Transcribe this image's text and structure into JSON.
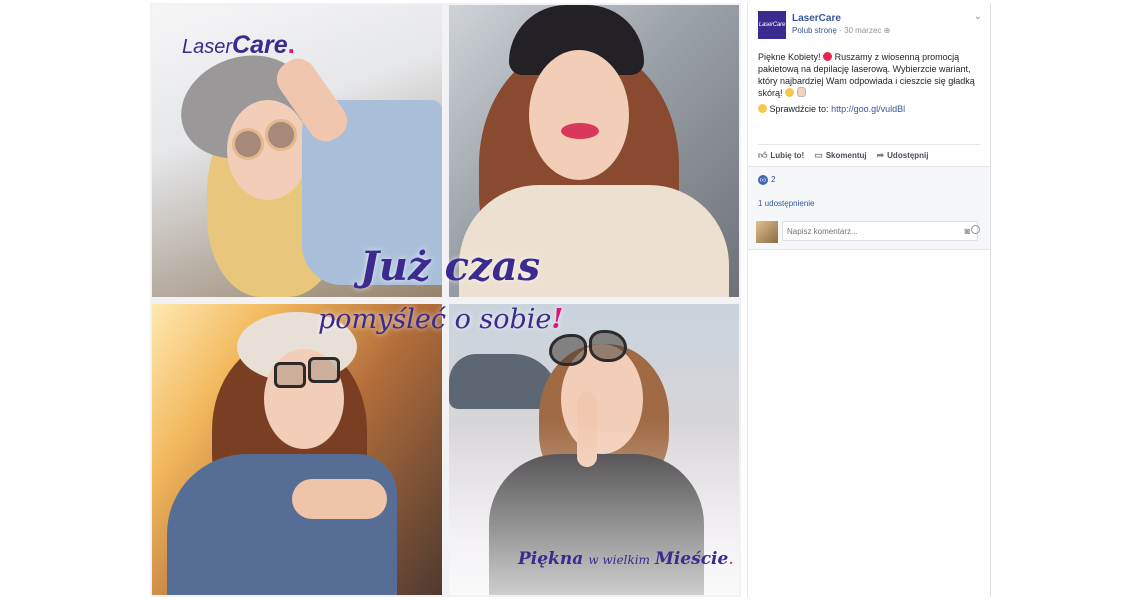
{
  "ad": {
    "logo_part1": "Laser",
    "logo_part2": "Care",
    "logo_dot": ".",
    "headline_line1": "Już czas",
    "headline_line2": "pomyśleć o sobie",
    "headline_bang": "!",
    "tagline_word1": "Piękna",
    "tagline_middle": "w wielkim",
    "tagline_word2": "Mieście",
    "tagline_dot": ".",
    "colors": {
      "brand_purple": "#3b2a8f",
      "brand_pink": "#e0117f"
    }
  },
  "post": {
    "page_avatar_text": "LaserCare",
    "page_name": "LaserCare",
    "like_page": "Polub stronę",
    "separator": "·",
    "date": "30 marzec",
    "privacy_icon": "globe-icon",
    "options_icon": "chevron-down-icon",
    "text_part1": "Piękne Kobiety!",
    "text_part2": "Ruszamy z wiosenną promocją pakietową na depilację laserową. Wybierzcie wariant, który najbardziej Wam odpowiada i cieszcie się gładką skórą!",
    "text_line2_prefix": "Sprawdźcie to:",
    "link": "http://goo.gl/vuldBl",
    "actions": {
      "like": "Lubię to!",
      "comment": "Skomentuj",
      "share": "Udostępnij"
    },
    "likes_count": "2",
    "shares_text": "1 udostępnienie",
    "comment_placeholder": "Napisz komentarz..."
  }
}
